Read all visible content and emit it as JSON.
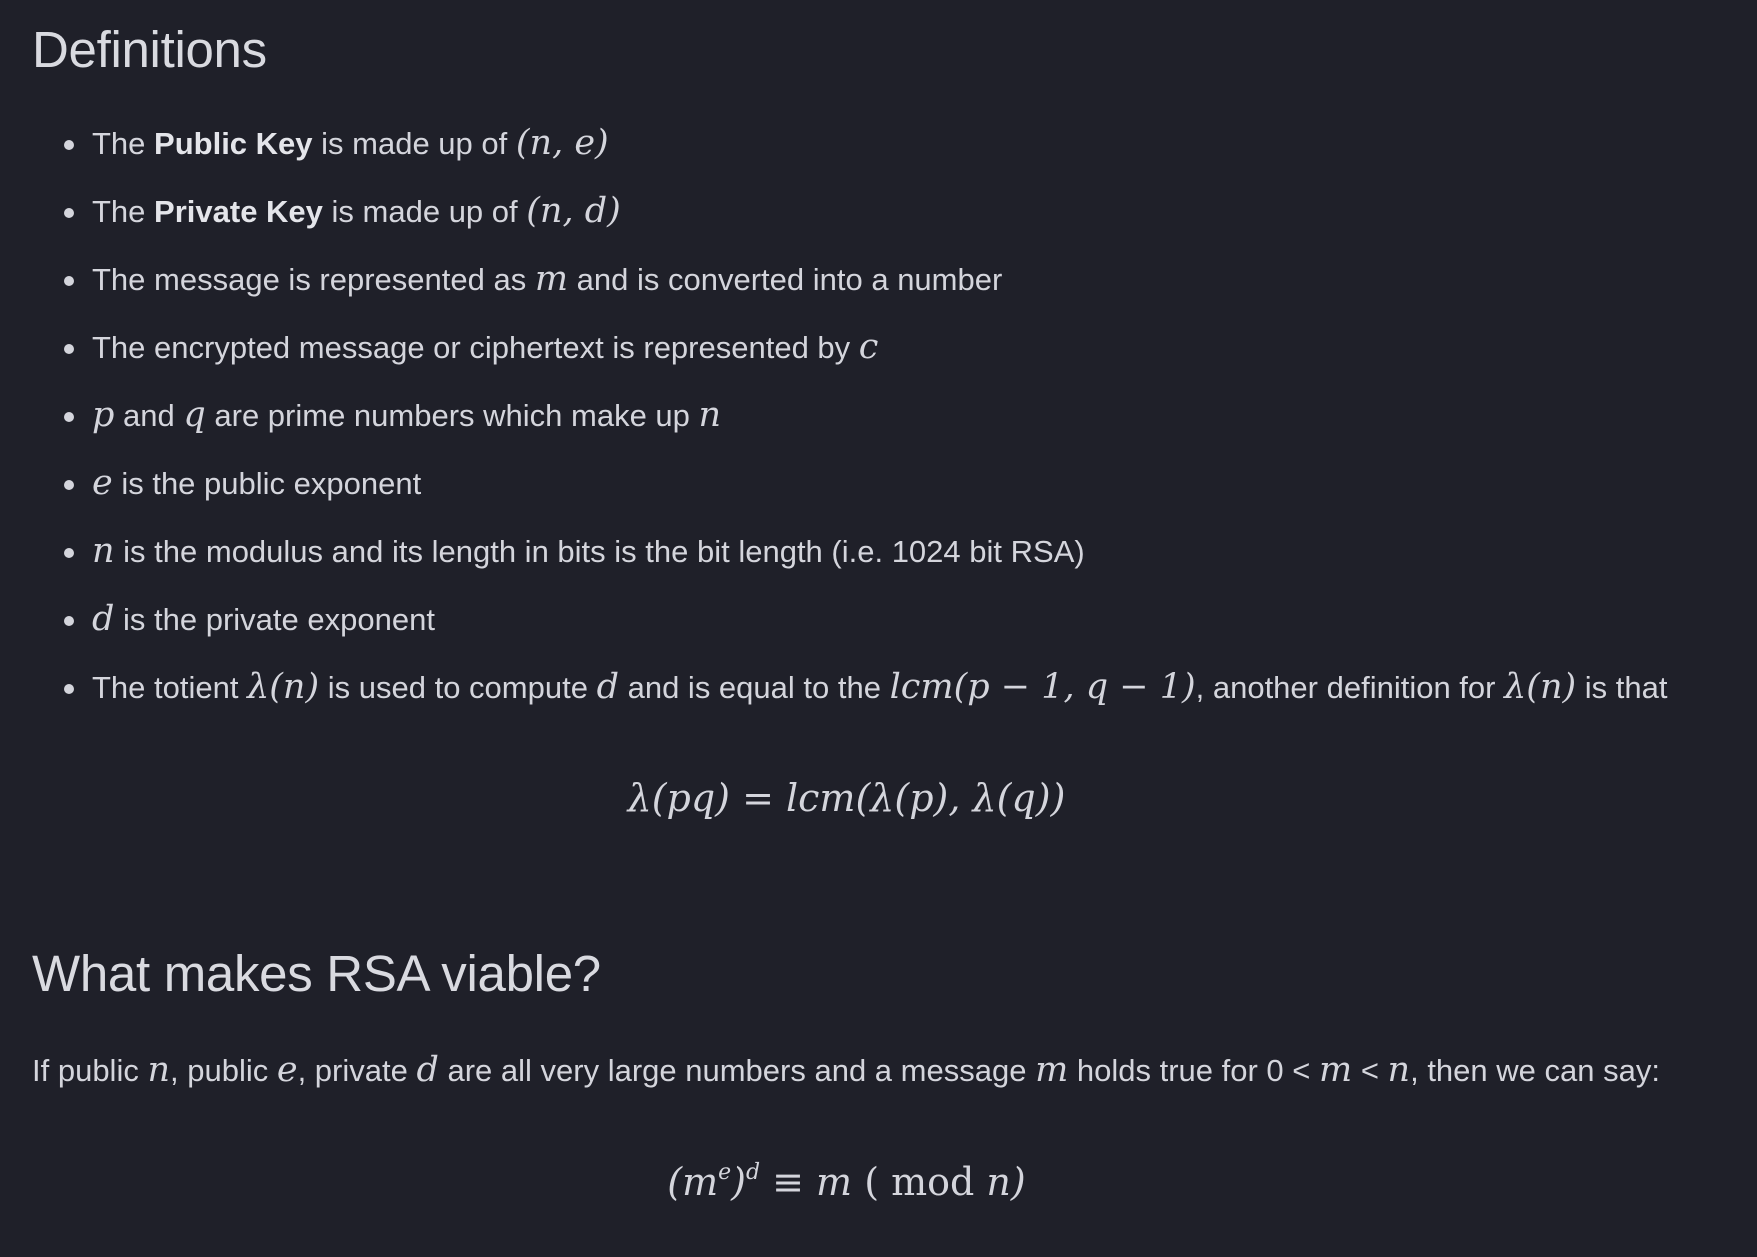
{
  "sections": {
    "definitions_title": "Definitions",
    "rsa_title": "What makes RSA viable?"
  },
  "items": {
    "i1": {
      "pre": "The ",
      "bold": "Public Key",
      "post": " is made up of ",
      "math": "(n, e)"
    },
    "i2": {
      "pre": "The ",
      "bold": "Private Key",
      "post": " is made up of ",
      "math": "(n, d)"
    },
    "i3": {
      "pre": "The message is represented as ",
      "math": "m",
      "post": " and is converted into a number"
    },
    "i4": {
      "pre": "The encrypted message or ciphertext is represented by ",
      "math": "c"
    },
    "i5": {
      "math1": "p",
      "mid1": " and ",
      "math2": "q",
      "mid2": " are prime numbers which make up ",
      "math3": "n"
    },
    "i6": {
      "math": "e",
      "post": " is the public exponent"
    },
    "i7": {
      "math": "n",
      "post": " is the modulus and its length in bits is the bit length (i.e. 1024 bit RSA)"
    },
    "i8": {
      "math": "d",
      "post": " is the private exponent"
    },
    "i9": {
      "pre": "The totient ",
      "math1": "λ(n)",
      "mid1": " is used to compute ",
      "math2": "d",
      "mid2": " and is equal to the ",
      "math3": "lcm(p − 1, q − 1)",
      "mid3": ", another definition for ",
      "math4": "λ(n)",
      "post": " is that"
    }
  },
  "equation1": "λ(pq) = lcm(λ(p), λ(q))",
  "paragraph": {
    "t1": "If public ",
    "m1": "n",
    "t2": ", public ",
    "m2": "e",
    "t3": ", private ",
    "m3": "d",
    "t4": " are all very large numbers and a message ",
    "m4": "m",
    "t5": " holds true for 0 < ",
    "m5": "m",
    "t6": " < ",
    "m6": "n",
    "t7": ", then we can say:"
  },
  "equation2": {
    "open": "(m",
    "e": "e",
    "close": ")",
    "d": "d",
    "rest_m": " ≡ m ",
    "mod": "( mod ",
    "n": " n)"
  }
}
